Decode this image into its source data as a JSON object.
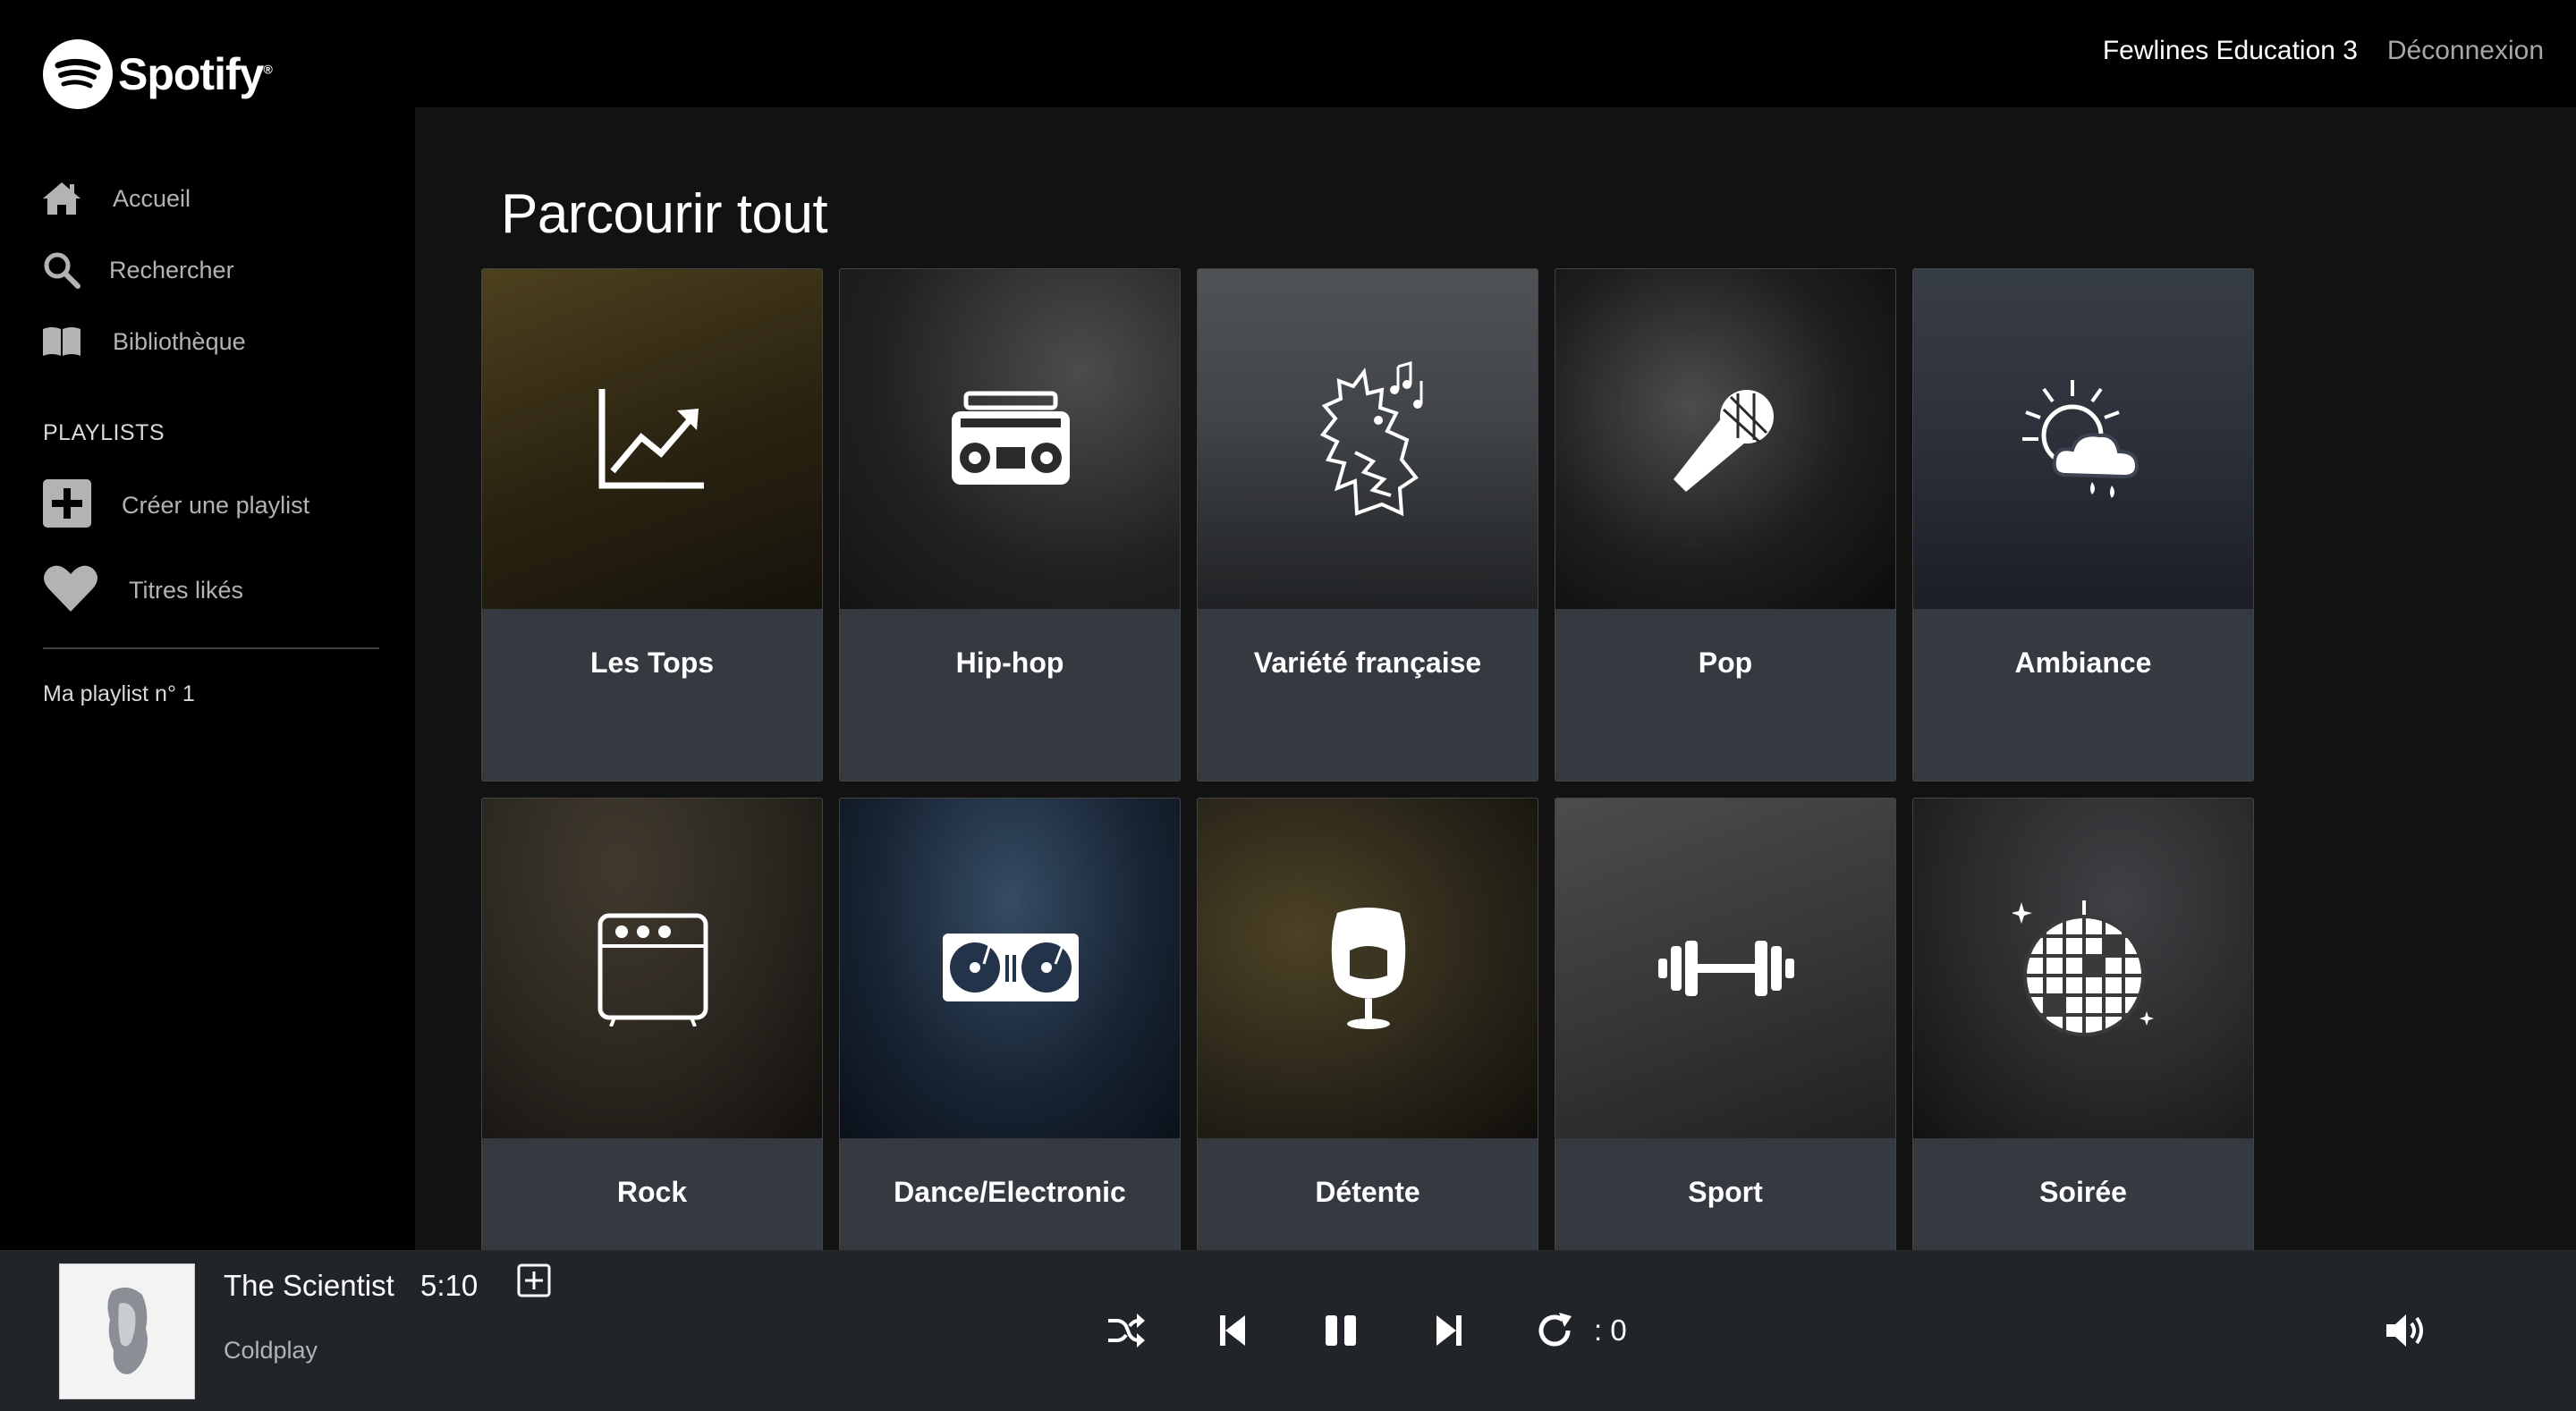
{
  "brand": {
    "name": "Spotify",
    "mark": "®"
  },
  "nav": [
    {
      "label": "Accueil",
      "icon": "home-icon"
    },
    {
      "label": "Rechercher",
      "icon": "search-icon"
    },
    {
      "label": "Bibliothèque",
      "icon": "library-icon"
    }
  ],
  "sidebar": {
    "playlists_title": "PLAYLISTS",
    "create_playlist": "Créer une playlist",
    "liked_titles": "Titres likés",
    "playlists": [
      "Ma playlist n° 1"
    ]
  },
  "header": {
    "user_name": "Fewlines Education 3",
    "logout_label": "Déconnexion"
  },
  "main": {
    "title": "Parcourir tout",
    "categories": [
      {
        "title": "Les Tops",
        "icon": "trending-chart-icon",
        "bg": "#4a3f22"
      },
      {
        "title": "Hip-hop",
        "icon": "boombox-icon",
        "bg": "#3a3a3a"
      },
      {
        "title": "Variété française",
        "icon": "rooster-icon",
        "bg": "#5a5f64"
      },
      {
        "title": "Pop",
        "icon": "microphone-icon",
        "bg": "#2b2b2b"
      },
      {
        "title": "Ambiance",
        "icon": "weather-icon",
        "bg": "#3d4350"
      },
      {
        "title": "Rock",
        "icon": "amplifier-icon",
        "bg": "#3a352c"
      },
      {
        "title": "Dance/Electronic",
        "icon": "turntables-icon",
        "bg": "#23344a"
      },
      {
        "title": "Détente",
        "icon": "egg-chair-icon",
        "bg": "#3b3524"
      },
      {
        "title": "Sport",
        "icon": "dumbbell-icon",
        "bg": "#4e4e4e"
      },
      {
        "title": "Soirée",
        "icon": "disco-ball-icon",
        "bg": "#3a3a3c"
      }
    ]
  },
  "player": {
    "track": "The Scientist",
    "duration": "5:10",
    "artist": "Coldplay",
    "repeat_count": ": 0",
    "controls": [
      "shuffle-icon",
      "previous-icon",
      "pause-icon",
      "next-icon",
      "repeat-icon"
    ],
    "volume_icon": "volume-icon"
  }
}
